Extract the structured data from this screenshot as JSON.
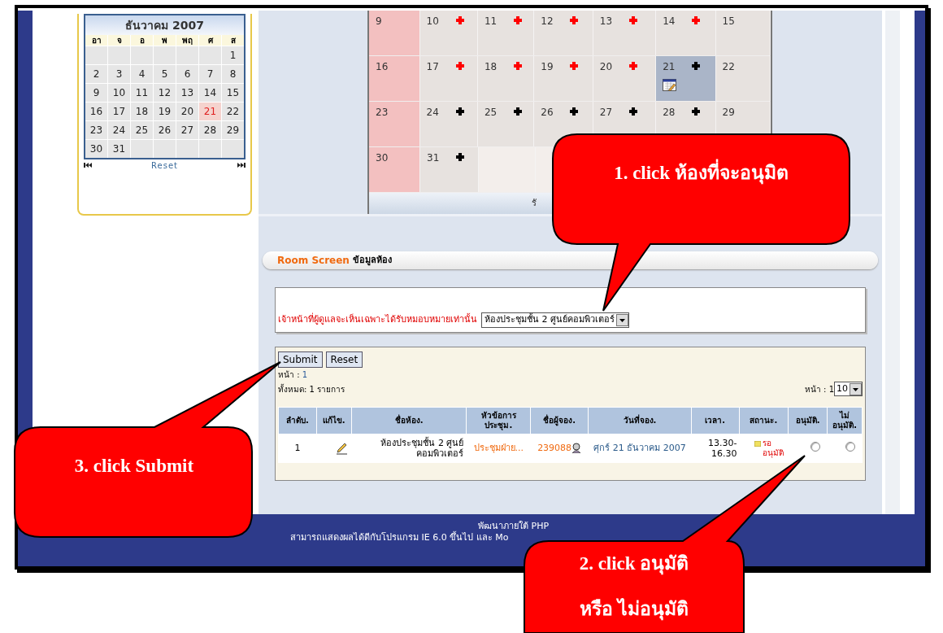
{
  "mini_calendar": {
    "title": "ธันวาคม 2007",
    "weekdays": [
      "อา",
      "จ",
      "อ",
      "พ",
      "พฤ",
      "ศ",
      "ส"
    ],
    "weeks": [
      [
        {
          "label": "1",
          "selected": false
        }
      ],
      [
        {
          "label": "2",
          "selected": false
        },
        {
          "label": "3",
          "selected": false
        },
        {
          "label": "4",
          "selected": false
        },
        {
          "label": "5",
          "selected": false
        },
        {
          "label": "6",
          "selected": false
        },
        {
          "label": "7",
          "selected": false
        },
        {
          "label": "8",
          "selected": false
        }
      ],
      [
        {
          "label": "9",
          "selected": false
        },
        {
          "label": "10",
          "selected": false
        },
        {
          "label": "11",
          "selected": false
        },
        {
          "label": "12",
          "selected": false
        },
        {
          "label": "13",
          "selected": false
        },
        {
          "label": "14",
          "selected": false
        },
        {
          "label": "15",
          "selected": false
        }
      ],
      [
        {
          "label": "16",
          "selected": false
        },
        {
          "label": "17",
          "selected": false
        },
        {
          "label": "18",
          "selected": false
        },
        {
          "label": "19",
          "selected": false
        },
        {
          "label": "20",
          "selected": false
        },
        {
          "label": "21",
          "selected": true
        },
        {
          "label": "22",
          "selected": false
        }
      ],
      [
        {
          "label": "23",
          "selected": false
        },
        {
          "label": "24",
          "selected": false
        },
        {
          "label": "25",
          "selected": false
        },
        {
          "label": "26",
          "selected": false
        },
        {
          "label": "27",
          "selected": false
        },
        {
          "label": "28",
          "selected": false
        },
        {
          "label": "29",
          "selected": false
        }
      ],
      [
        {
          "label": "30",
          "selected": false
        },
        {
          "label": "31",
          "selected": false
        }
      ]
    ],
    "reset": "Reset"
  },
  "month_calendar": {
    "weeks": [
      [
        {
          "kind": "sunday",
          "label": "9"
        },
        {
          "kind": "day",
          "label": "10",
          "color": "#ff0000"
        },
        {
          "kind": "day",
          "label": "11",
          "color": "#ff0000"
        },
        {
          "kind": "day",
          "label": "12",
          "color": "#ff0000"
        },
        {
          "kind": "day",
          "label": "13",
          "color": "#ff0000"
        },
        {
          "kind": "day",
          "label": "14",
          "color": "#ff0000"
        },
        {
          "kind": "day",
          "label": "15"
        }
      ],
      [
        {
          "kind": "sunday",
          "label": "16"
        },
        {
          "kind": "day",
          "label": "17",
          "color": "#ff0000"
        },
        {
          "kind": "day",
          "label": "18",
          "color": "#ff0000"
        },
        {
          "kind": "day",
          "label": "19",
          "color": "#ff0000"
        },
        {
          "kind": "day",
          "label": "20",
          "color": "#ff0000"
        },
        {
          "kind": "day",
          "label": "21",
          "color": "#000000",
          "selected": true,
          "booked": true
        },
        {
          "kind": "day",
          "label": "22"
        }
      ],
      [
        {
          "kind": "sunday",
          "label": "23"
        },
        {
          "kind": "day",
          "label": "24",
          "color": "#000000"
        },
        {
          "kind": "day",
          "label": "25",
          "color": "#000000"
        },
        {
          "kind": "day",
          "label": "26",
          "color": "#000000"
        },
        {
          "kind": "day",
          "label": "27",
          "color": "#000000"
        },
        {
          "kind": "day",
          "label": "28",
          "color": "#000000"
        },
        {
          "kind": "day",
          "label": "29"
        }
      ],
      [
        {
          "kind": "sunday",
          "label": "30"
        },
        {
          "kind": "day",
          "label": "31",
          "color": "#000000"
        },
        {
          "kind": "blank"
        },
        {
          "kind": "blank"
        }
      ]
    ],
    "footer": "รั"
  },
  "room_screen": {
    "title": "Room Screen",
    "subtitle": "ข้อมูลห้อง",
    "filter_label": "เจ้าหน้าที่ผู้ดูแลจะเห็นเฉพาะได้รับหมอบหมายเท่านั้น",
    "room_select": "ห้องประชุมชั้น 2 ศูนย์คอมพิวเตอร์",
    "buttons": [
      "Submit",
      "Reset"
    ],
    "page_label": "หน้า : ",
    "page_link": "1",
    "total": "ทั้งหมด: 1 รายการ",
    "pager_label": "หน้า : 1",
    "page_size": "10",
    "table": {
      "columns": [
        "ลำดับ.",
        "แก้ไข.",
        "ชื่อห้อง.",
        "หัวข้อการประชุม.",
        "ชื่อผู้จอง.",
        "วันที่จอง.",
        "เวลา.",
        "สถานะ.",
        "อนุมัติ.",
        "ไม่อนุมัติ."
      ],
      "rows": [
        {
          "no": "1",
          "room": "ห้องประชุมชั้น 2 ศูนย์คอมพิวเตอร์",
          "topic": "ประชุมฝ่าย...",
          "booker": "239088",
          "date": "ศุกร์ 21 ธันวาคม 2007",
          "time": "13.30-16.30",
          "status": "รอ อนุมัติ",
          "approve": false,
          "reject": false
        }
      ]
    }
  },
  "footer": [
    "พัฒนาภายใต้ PHP",
    "สามารถแสดงผลได้ดีกับโปรแกรม IE 6.0 ขึ้นไป และ Mo"
  ],
  "callouts": [
    "1. click ห้องที่จะอนุมิต",
    "2. click อนุมัติ",
    "หรือ ไม่อนุมัติ",
    "3. click Submit"
  ]
}
